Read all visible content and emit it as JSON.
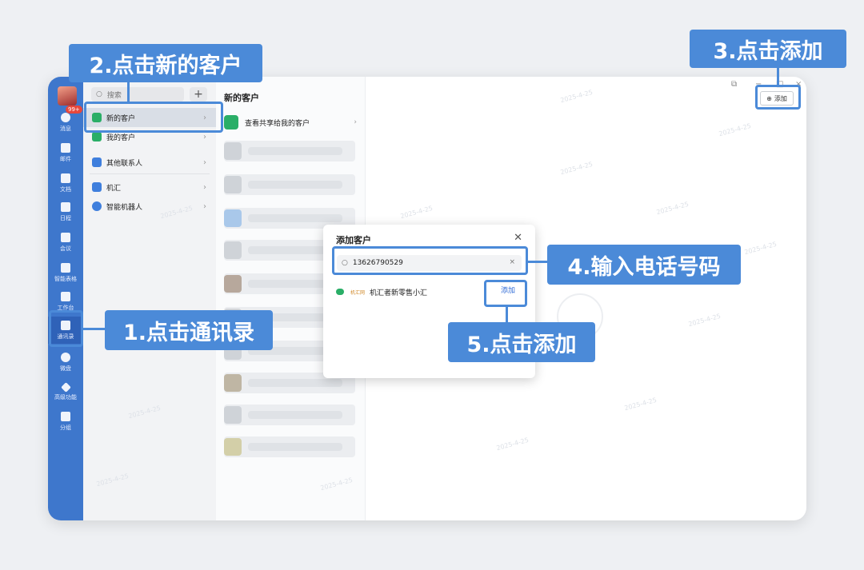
{
  "nav": {
    "badge": "99+",
    "items": [
      {
        "label": "消息"
      },
      {
        "label": "邮件"
      },
      {
        "label": "文档"
      },
      {
        "label": "日程"
      },
      {
        "label": "会议"
      },
      {
        "label": "智能表格"
      },
      {
        "label": "工作台"
      },
      {
        "label": "通讯录"
      },
      {
        "label": "微盘"
      },
      {
        "label": "高级功能"
      },
      {
        "label": "分组"
      }
    ]
  },
  "contacts": {
    "search_placeholder": "搜索",
    "add_symbol": "+",
    "items": [
      {
        "label": "新的客户"
      },
      {
        "label": "我的客户"
      },
      {
        "label": "其他联系人"
      },
      {
        "label": "机汇"
      },
      {
        "label": "智能机器人"
      }
    ]
  },
  "main": {
    "title": "新的客户",
    "shared_link": "查看共享给我的客户",
    "add_button": "添加"
  },
  "dialog": {
    "title": "添加客户",
    "phone": "13626790529",
    "result_name": "机汇者新零售小汇",
    "result_tag": "机汇网",
    "result_add": "添加"
  },
  "callouts": {
    "step1": "1.点击通讯录",
    "step2": "2.点击新的客户",
    "step3": "3.点击添加",
    "step4": "4.输入电话号码",
    "step5": "5.点击添加"
  },
  "watermark": {
    "date": "2025-4-25"
  },
  "colors": {
    "accent": "#4b8ad8",
    "rail": "#3e77cc"
  }
}
